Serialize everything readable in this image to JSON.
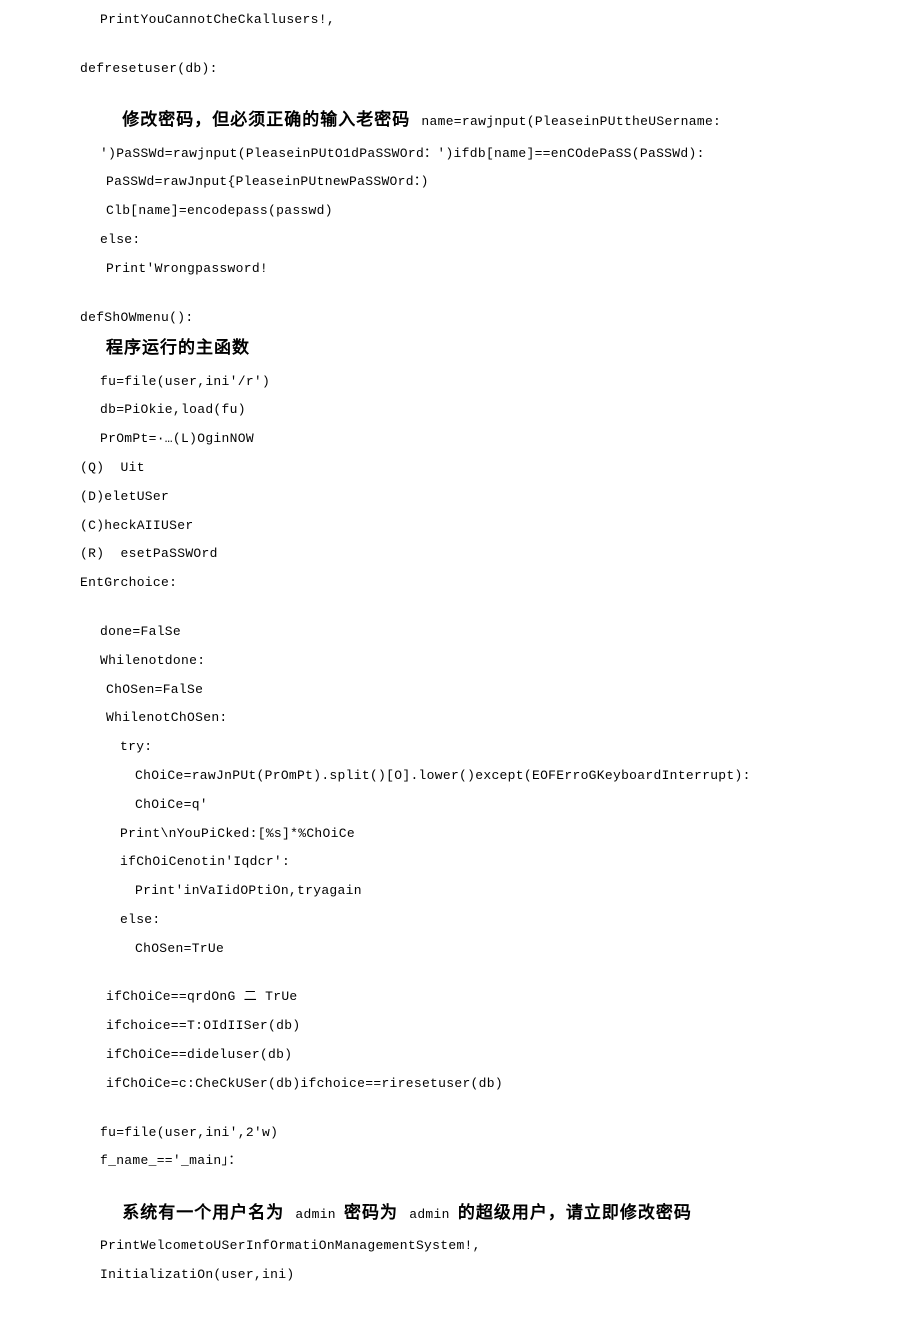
{
  "lines": {
    "l01": "PrintYouCannotCheCkallusers!,",
    "l02": "defresetuser(db):",
    "l03_cn": "修改密码，但必须正确的输入老密码 ",
    "l03_en": "name=rawjnput(PleaseinPUttheUSername:",
    "l04": "')PaSSWd=rawjnput(PleaseinPUtO1dPaSSWOrd：')ifdb[name]==enCOdePaSS(PaSSWd):",
    "l05": "PaSSWd=rawJnput{PleaseinPUtnewPaSSWOrd：)",
    "l06": "Clb[name]=encodepass(passwd)",
    "l07": "else:",
    "l08": "Print'Wrongpassword!",
    "l09": "defShOWmenu():",
    "l10": "程序运行的主函数",
    "l11": "fu=file(user,ini'/r')",
    "l12": "db=PiOkie,load(fu)",
    "l13": "PrOmPt=·…(L)OginNOW",
    "l14": "(Q)  Uit",
    "l15": "(D)eletUSer",
    "l16": "(C)heckAIIUSer",
    "l17": "(R)  esetPaSSWOrd",
    "l18": "EntGrchoice:",
    "l19": "done=FalSe",
    "l20": "Whilenotdone:",
    "l21": "ChOSen=FalSe",
    "l22": "WhilenotChOSen:",
    "l23": "try:",
    "l24": "ChOiCe=rawJnPUt(PrOmPt).split()[O].lower()except(EOFErroGKeyboardInterrupt):",
    "l25": "ChOiCe=q'",
    "l26": "Print\\nYouPiCked:[%s]*%ChOiCe",
    "l27": "ifChOiCenotin′Iqdcr':",
    "l28": "Print'inVaIidOPtiOn,tryagain",
    "l29": "else:",
    "l30": "ChOSen=TrUe",
    "l31": "ifChOiCe==qrdOnG 二 TrUe",
    "l32": "ifchoice==T:OIdIISer(db)",
    "l33": "ifChOiCe==dideluser(db)",
    "l34": "ifChOiCe=c:CheCkUSer(db)ifchoice==riresetuser(db)",
    "l35": "fu=file(user,ini',2'w)",
    "l36": "f_name_=='_main」：",
    "l37_cn": "系统有一个用户名为 ",
    "l37_mid1": "admin ",
    "l37_cn2": "密码为 ",
    "l37_mid2": "admin ",
    "l37_cn3": "的超级用户，请立即修改密码",
    "l38": "PrintWelcometoUSerInfOrmatiOnManagementSystem!,",
    "l39": "InitializatiOn(user,ini)"
  }
}
